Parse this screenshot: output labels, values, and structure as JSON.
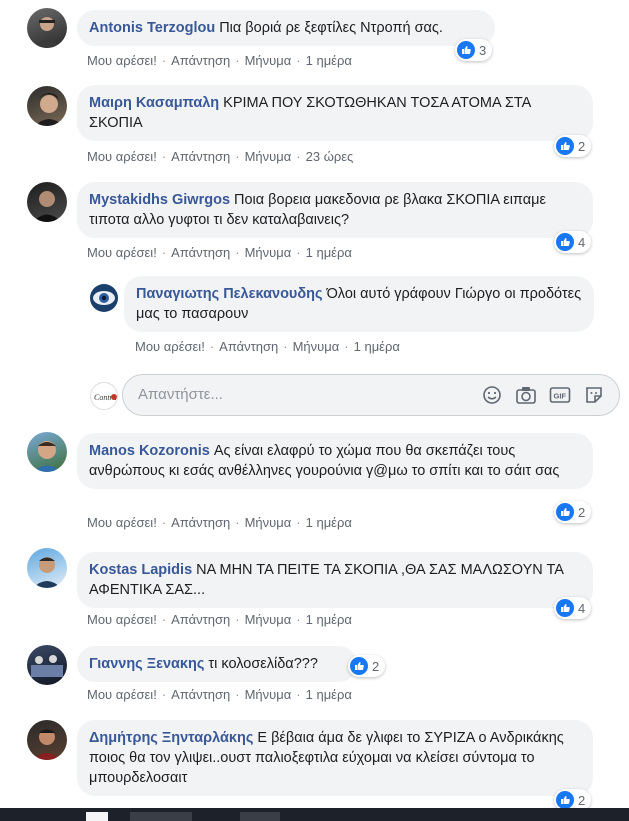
{
  "actions": {
    "like": "Μου αρέσει!",
    "reply": "Απάντηση",
    "message": "Μήνυμα"
  },
  "comments": [
    {
      "author": "Antonis Terzoglou",
      "text": "Πια βοριά ρε ξεφτίλες Ντροπή σας.",
      "time": "1 ημέρα",
      "likes": "3"
    },
    {
      "author": "Μαιρη Κασαμπαλη",
      "text": "ΚΡΙΜΑ ΠΟΥ ΣΚΟΤΩΘΗΚΑΝ ΤΟΣΑ ΑΤΟΜΑ ΣΤΑ ΣΚΟΠΙΑ",
      "time": "23 ώρες",
      "likes": "2"
    },
    {
      "author": "Mystakidhs Giwrgos",
      "text": "Ποια βορεια μακεδονια ρε βλακα ΣΚΟΠΙΑ ειπαμε τιποτα αλλο γυφτοι τι δεν καταλαβαινεις?",
      "time": "1 ημέρα",
      "likes": "4"
    },
    {
      "author": "Παναγιωτης Πελεκανουδης",
      "text": "Όλοι αυτό γράφουν Γιώργο οι προδότες μας το πασαρουν",
      "time": "1 ημέρα",
      "likes": ""
    },
    {
      "author": "Manos Kozoronis",
      "text": "Ας είναι ελαφρύ το χώμα που θα σκεπάζει τους ανθρώπους κι εσάς ανθέλληνες γουρούνια γ@μω το σπίτι και το σάιτ σας",
      "time": "1 ημέρα",
      "likes": "2"
    },
    {
      "author": "Kostas Lapidis",
      "text": "ΝΑ ΜΗΝ ΤΑ ΠΕΙΤΕ ΤΑ ΣΚΟΠΙΑ ,ΘΑ ΣΑΣ ΜΑΛΩΣΟΥΝ ΤΑ ΑΦΕΝΤΙΚΑ ΣΑΣ...",
      "time": "1 ημέρα",
      "likes": "4"
    },
    {
      "author": "Γιαννης Ξενακης",
      "text": "τι κολοσελίδα???",
      "time": "1 ημέρα",
      "likes": "2"
    },
    {
      "author": "Δημήτρης Ξηνταρλάκης",
      "text": "Ε βέβαια άμα δε γλιφει το ΣΥΡΙΖΑ ο Ανδρικάκης ποιος θα τον γλιψει..ουστ παλιοξεφτιλα εύχομαι να κλείσει σύντομα το μπουρδελοσαιτ",
      "time": "",
      "likes": "2"
    }
  ],
  "reply_box": {
    "placeholder": "Απαντήστε..."
  },
  "reply_avatar_logo": "Contra",
  "colors": {
    "author": "#385898",
    "bubble": "#f2f3f5",
    "like": "#1877f2",
    "meta": "#606770"
  }
}
